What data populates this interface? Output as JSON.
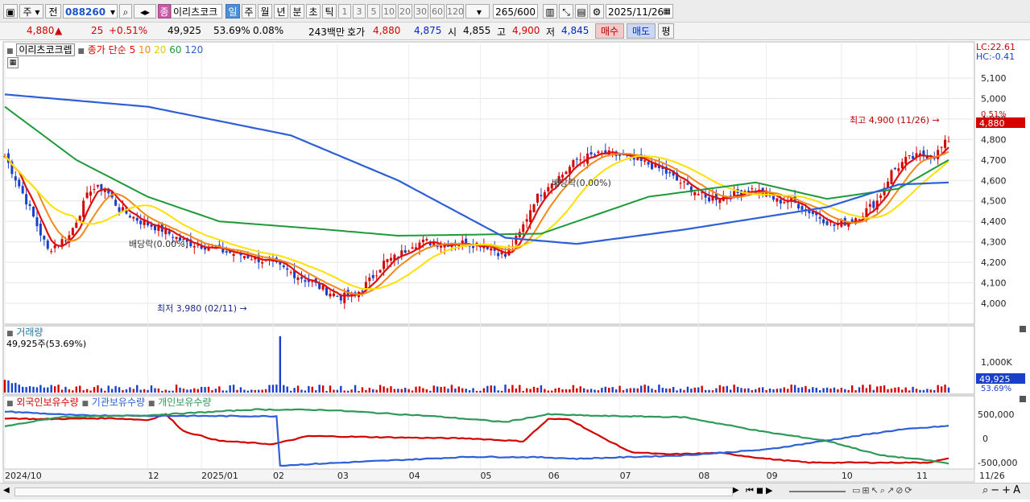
{
  "toolbar": {
    "mode_primary": "주",
    "mode_secondary": "전",
    "stock_code": "088260",
    "stock_name": "이리츠코크",
    "type_badge": "종",
    "periods": [
      "일",
      "주",
      "월",
      "년",
      "분",
      "초",
      "틱"
    ],
    "selected_period": "일",
    "interval_numbers": [
      "1",
      "3",
      "5",
      "10",
      "20",
      "30",
      "60",
      "120"
    ],
    "count_display": "265",
    "count_total": "/600",
    "date": "2025/11/26"
  },
  "quote": {
    "price": "4,880",
    "direction_symbol": "▲",
    "change": "25",
    "change_pct": "+0.51%",
    "volume": "49,925",
    "volume_ratio": "53.69%",
    "turnover_pct": "0.08%",
    "amount": "243백만",
    "ask_label": "호가",
    "ask": "4,880",
    "bid": "4,875",
    "open_label": "시",
    "open": "4,855",
    "high_label": "고",
    "high": "4,900",
    "low_label": "저",
    "low": "4,845",
    "buy_label": "매수",
    "sell_label": "매도",
    "eval_label": "평"
  },
  "price_panel": {
    "legend_name": "이리츠코크렙",
    "legend_type": "종가 단순",
    "ma_periods": [
      "5",
      "10",
      "20",
      "60",
      "120"
    ],
    "lc_label": "LC:22.61",
    "hc_label": "HC:-0.41",
    "current_price_tag": "4,880",
    "current_pct_tag": "0.51%",
    "high_annotation": "최고 4,900 (11/26)",
    "low_annotation": "최저 3,980 (02/11)",
    "dividend_annotation_1": "배당락(0.00%)",
    "dividend_annotation_2": "배당락(0.00%)",
    "y_ticks": [
      "5,100",
      "5,000",
      "4,900",
      "4,800",
      "4,700",
      "4,600",
      "4,500",
      "4,400",
      "4,300",
      "4,200",
      "4,100",
      "4,000"
    ]
  },
  "volume_panel": {
    "title": "거래량",
    "value_label": "49,925주(53.69%)",
    "y_tick": "1,000K",
    "current_tag": "49,925",
    "current_pct": "53.69%"
  },
  "holdings_panel": {
    "legend": [
      "외국인보유수량",
      "기관보유수량",
      "개인보유수량"
    ],
    "y_ticks": [
      "500,000",
      "0",
      "-500,000"
    ]
  },
  "x_axis": {
    "labels": [
      "2024/10",
      "12",
      "2025/01",
      "02",
      "03",
      "04",
      "05",
      "06",
      "07",
      "08",
      "09",
      "10",
      "11",
      "11/26"
    ]
  },
  "colors": {
    "up": "#d40000",
    "down": "#1a3fc8",
    "ma5": "#e01010",
    "ma10": "#f08a1c",
    "ma20": "#ffe000",
    "ma60": "#1f9a3a",
    "ma120": "#2e5fd6",
    "foreign": "#d40000",
    "institution": "#2e5fd6",
    "individual": "#2e9a5a"
  }
}
